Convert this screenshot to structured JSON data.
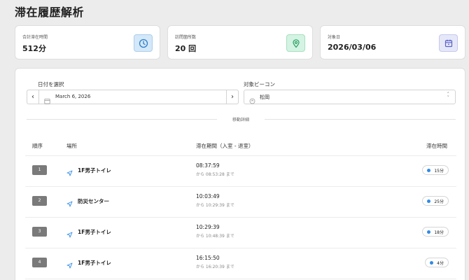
{
  "page": {
    "title": "滞在履歴解析"
  },
  "stats": [
    {
      "label": "合計滞在時間",
      "value": "512分",
      "icon": "clock-icon",
      "color": "#2f7fc9"
    },
    {
      "label": "訪問箇所数",
      "value": "20 回",
      "icon": "location-pin-icon",
      "color": "#23a062"
    },
    {
      "label": "対象日",
      "value": "2026/03/06",
      "icon": "calendar-icon",
      "color": "#5a63c8"
    }
  ],
  "filters": {
    "date_label": "日付を選択",
    "date_value": "March 6, 2026",
    "prev_glyph": "‹",
    "next_glyph": "›",
    "beacon_label": "対象ビーコン",
    "beacon_value": "松岡"
  },
  "section": {
    "divider_text": "移動詳細"
  },
  "table": {
    "headers": {
      "order": "順序",
      "location": "場所",
      "period": "滞在期間（入室 - 退室）",
      "duration": "滞在時間"
    },
    "rows": [
      {
        "order": "1",
        "location": "1F男子トイレ",
        "start": "08:37:59",
        "until": "から 08:53:28 まで",
        "duration": "15分"
      },
      {
        "order": "2",
        "location": "防災センター",
        "start": "10:03:49",
        "until": "から 10:29:39 まで",
        "duration": "25分"
      },
      {
        "order": "3",
        "location": "1F男子トイレ",
        "start": "10:29:39",
        "until": "から 10:48:39 まで",
        "duration": "18分"
      },
      {
        "order": "4",
        "location": "1F男子トイレ",
        "start": "16:15:50",
        "until": "から 16:20:39 まで",
        "duration": "4分"
      }
    ]
  },
  "colors": {
    "accent": "#2f8be6",
    "badge": "#7a7a7a"
  }
}
